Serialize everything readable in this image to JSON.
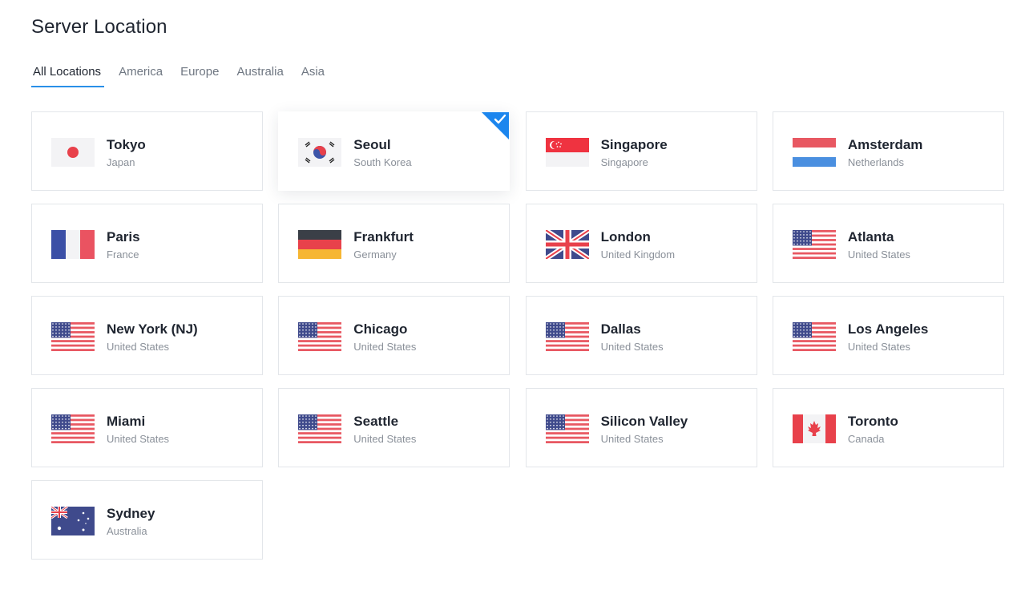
{
  "title": "Server Location",
  "tabs": [
    {
      "label": "All Locations",
      "active": true
    },
    {
      "label": "America",
      "active": false
    },
    {
      "label": "Europe",
      "active": false
    },
    {
      "label": "Australia",
      "active": false
    },
    {
      "label": "Asia",
      "active": false
    }
  ],
  "accent_color": "#2a8fe8",
  "selected_location": "Seoul",
  "locations": [
    {
      "city": "Tokyo",
      "country": "Japan",
      "flag": "japan-flag-icon"
    },
    {
      "city": "Seoul",
      "country": "South Korea",
      "flag": "south-korea-flag-icon",
      "selected": true
    },
    {
      "city": "Singapore",
      "country": "Singapore",
      "flag": "singapore-flag-icon"
    },
    {
      "city": "Amsterdam",
      "country": "Netherlands",
      "flag": "netherlands-flag-icon"
    },
    {
      "city": "Paris",
      "country": "France",
      "flag": "france-flag-icon"
    },
    {
      "city": "Frankfurt",
      "country": "Germany",
      "flag": "germany-flag-icon"
    },
    {
      "city": "London",
      "country": "United Kingdom",
      "flag": "uk-flag-icon"
    },
    {
      "city": "Atlanta",
      "country": "United States",
      "flag": "us-flag-icon"
    },
    {
      "city": "New York (NJ)",
      "country": "United States",
      "flag": "us-flag-icon"
    },
    {
      "city": "Chicago",
      "country": "United States",
      "flag": "us-flag-icon"
    },
    {
      "city": "Dallas",
      "country": "United States",
      "flag": "us-flag-icon"
    },
    {
      "city": "Los Angeles",
      "country": "United States",
      "flag": "us-flag-icon"
    },
    {
      "city": "Miami",
      "country": "United States",
      "flag": "us-flag-icon"
    },
    {
      "city": "Seattle",
      "country": "United States",
      "flag": "us-flag-icon"
    },
    {
      "city": "Silicon Valley",
      "country": "United States",
      "flag": "us-flag-icon"
    },
    {
      "city": "Toronto",
      "country": "Canada",
      "flag": "canada-flag-icon"
    },
    {
      "city": "Sydney",
      "country": "Australia",
      "flag": "australia-flag-icon"
    }
  ]
}
